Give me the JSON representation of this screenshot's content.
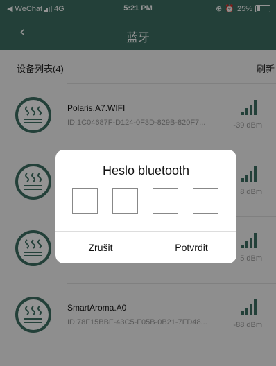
{
  "status_bar": {
    "carrier": "◀ WeChat",
    "network": "4G",
    "time": "5:21 PM",
    "battery": "25%"
  },
  "nav": {
    "back_icon": "chevron-left-icon",
    "title": "蓝牙"
  },
  "list": {
    "count_label": "设备列表(4)",
    "refresh_label": "刷新",
    "devices": [
      {
        "name": "Polaris.A7.WIFI",
        "id": "ID:1C04687F-D124-0F3D-829B-820F7...",
        "rssi": "-39 dBm"
      },
      {
        "name": "",
        "id": "",
        "rssi": "8 dBm"
      },
      {
        "name": "",
        "id": "",
        "rssi": "5 dBm"
      },
      {
        "name": "SmartAroma.A0",
        "id": "ID:78F15BBF-43C5-F05B-0B21-7FD48...",
        "rssi": "-88 dBm"
      }
    ]
  },
  "dialog": {
    "title": "Heslo bluetooth",
    "pin_length": 4,
    "cancel_label": "Zrušit",
    "confirm_label": "Potvrdit"
  },
  "colors": {
    "accent": "#3d6f62",
    "overlay": "rgba(0,0,0,0.42)"
  }
}
